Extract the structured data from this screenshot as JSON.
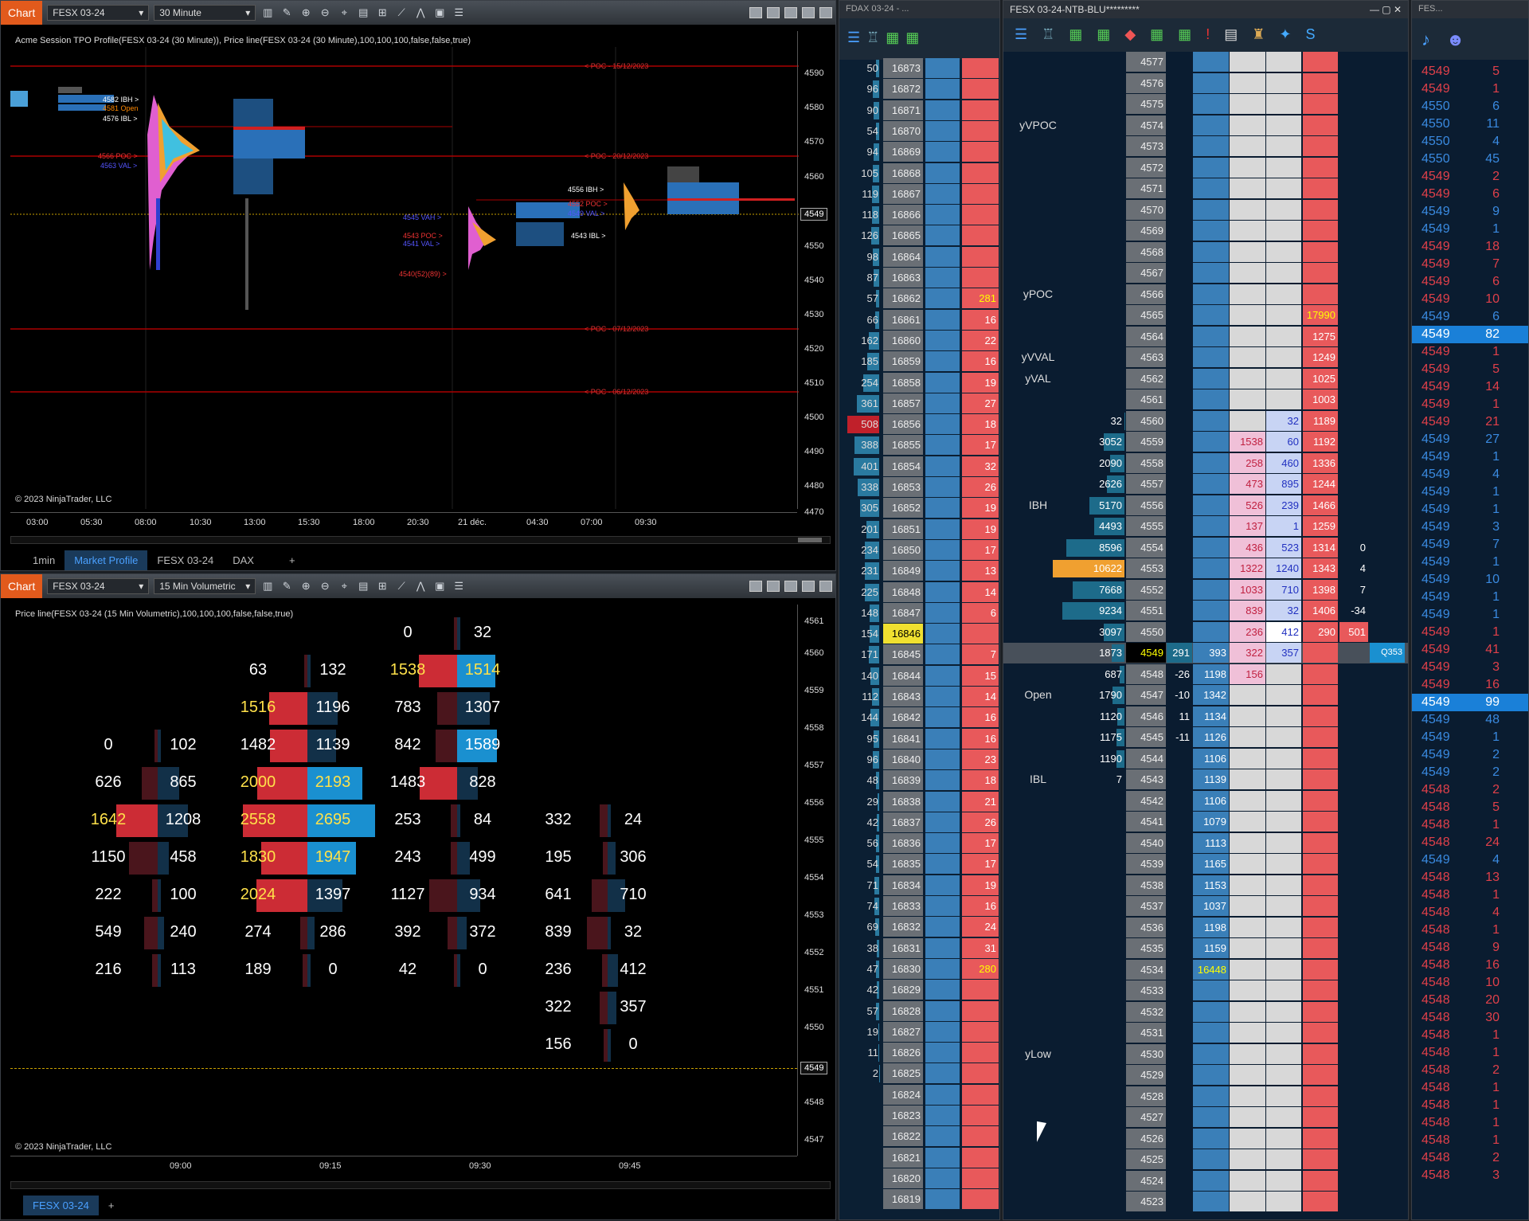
{
  "top_chart": {
    "tab_chip": "Chart",
    "instrument": "FESX 03-24",
    "interval": "30 Minute",
    "title": "Acme Session TPO Profile(FESX 03-24 (30 Minute)), Price line(FESX 03-24 (30 Minute),100,100,100,false,false,true)",
    "copyright": "© 2023 NinjaTrader, LLC",
    "price_axis": [
      "4590",
      "4580",
      "4570",
      "4560",
      "4550",
      "4540",
      "4530",
      "4520",
      "4510",
      "4500",
      "4490",
      "4480",
      "4470"
    ],
    "last_price": "4549",
    "time_axis": [
      "03:00",
      "05:30",
      "08:00",
      "10:30",
      "13:00",
      "15:30",
      "18:00",
      "20:30",
      "21 déc.",
      "04:30",
      "07:00",
      "09:30"
    ],
    "poc_lines": [
      "< POC - 15/12/2023",
      "< POC - 20/12/2023",
      "< POC - 07/12/2023",
      "< POC - 06/12/2023"
    ],
    "labels_left": [
      "4582 IBH >",
      "4581 Open",
      "4576 IBL >",
      "4566 POC >",
      "4563 VAL >"
    ],
    "labels_right": [
      "4556 IBH >",
      "4552 POC >",
      "4549 VAL >",
      "4543 IBL >",
      "4545 VAH >",
      "4543 POC >",
      "4541 VAL >",
      "4540(52)(89) >"
    ],
    "tabs": [
      "1min",
      "Market Profile",
      "FESX 03-24",
      "DAX",
      "+"
    ],
    "active_tab": "Market Profile"
  },
  "bottom_chart": {
    "tab_chip": "Chart",
    "instrument": "FESX 03-24",
    "interval": "15 Min Volumetric",
    "title": "Price line(FESX 03-24 (15 Min Volumetric),100,100,100,false,false,true)",
    "copyright": "© 2023 NinjaTrader, LLC",
    "price_axis": [
      "4561",
      "4560",
      "4559",
      "4558",
      "4557",
      "4556",
      "4555",
      "4554",
      "4553",
      "4552",
      "4551",
      "4550",
      "4549",
      "4548",
      "4547"
    ],
    "last_price": "4549",
    "time_axis": [
      "09:00",
      "09:15",
      "09:30",
      "09:45"
    ],
    "tabs": [
      "FESX 03-24",
      "+"
    ],
    "bars": [
      {
        "rows": [
          [
            "0",
            "102"
          ],
          [
            "626",
            "865"
          ],
          [
            "1642",
            "1208"
          ],
          [
            "1150",
            "458"
          ],
          [
            "222",
            "100"
          ],
          [
            "549",
            "240"
          ],
          [
            "216",
            "113"
          ]
        ]
      },
      {
        "rows": [
          [
            "63",
            "132"
          ],
          [
            "1516",
            "1196"
          ],
          [
            "1482",
            "1139"
          ],
          [
            "2000",
            "2193"
          ],
          [
            "2558",
            "2695"
          ],
          [
            "1830",
            "1947"
          ],
          [
            "2024",
            "1397"
          ],
          [
            "274",
            "286"
          ],
          [
            "189",
            "0"
          ]
        ]
      },
      {
        "rows": [
          [
            "0",
            "32"
          ],
          [
            "1538",
            "1514"
          ],
          [
            "783",
            "1307"
          ],
          [
            "842",
            "1589"
          ],
          [
            "1483",
            "828"
          ],
          [
            "253",
            "84"
          ],
          [
            "243",
            "499"
          ],
          [
            "1127",
            "934"
          ],
          [
            "392",
            "372"
          ],
          [
            "42",
            "0"
          ]
        ]
      },
      {
        "rows": [
          [
            "332",
            "24"
          ],
          [
            "195",
            "306"
          ],
          [
            "641",
            "710"
          ],
          [
            "839",
            "32"
          ],
          [
            "236",
            "412"
          ],
          [
            "322",
            "357"
          ],
          [
            "156",
            "0"
          ]
        ]
      }
    ]
  },
  "fdax_ladder": {
    "title": "FDAX 03-24 - ...",
    "rows": [
      [
        "50",
        "16873",
        ""
      ],
      [
        "96",
        "16872",
        ""
      ],
      [
        "90",
        "16871",
        ""
      ],
      [
        "54",
        "16870",
        ""
      ],
      [
        "94",
        "16869",
        ""
      ],
      [
        "105",
        "16868",
        ""
      ],
      [
        "119",
        "16867",
        ""
      ],
      [
        "118",
        "16866",
        ""
      ],
      [
        "126",
        "16865",
        ""
      ],
      [
        "98",
        "16864",
        ""
      ],
      [
        "87",
        "16863",
        ""
      ],
      [
        "57",
        "16862",
        "281"
      ],
      [
        "66",
        "16861",
        "16"
      ],
      [
        "162",
        "16860",
        "22"
      ],
      [
        "185",
        "16859",
        "16"
      ],
      [
        "254",
        "16858",
        "19"
      ],
      [
        "361",
        "16857",
        "27"
      ],
      [
        "508",
        "16856",
        "18"
      ],
      [
        "388",
        "16855",
        "17"
      ],
      [
        "401",
        "16854",
        "32"
      ],
      [
        "338",
        "16853",
        "26"
      ],
      [
        "305",
        "16852",
        "19"
      ],
      [
        "201",
        "16851",
        "19"
      ],
      [
        "234",
        "16850",
        "17"
      ],
      [
        "231",
        "16849",
        "13"
      ],
      [
        "225",
        "16848",
        "14"
      ],
      [
        "148",
        "16847",
        "6"
      ],
      [
        "154",
        "16846",
        ""
      ],
      [
        "171",
        "16845",
        "7"
      ],
      [
        "140",
        "16844",
        "15"
      ],
      [
        "112",
        "16843",
        "14"
      ],
      [
        "144",
        "16842",
        "16"
      ],
      [
        "95",
        "16841",
        "16"
      ],
      [
        "96",
        "16840",
        "23"
      ],
      [
        "48",
        "16839",
        "18"
      ],
      [
        "29",
        "16838",
        "21"
      ],
      [
        "42",
        "16837",
        "26"
      ],
      [
        "56",
        "16836",
        "17"
      ],
      [
        "54",
        "16835",
        "17"
      ],
      [
        "71",
        "16834",
        "19"
      ],
      [
        "74",
        "16833",
        "16"
      ],
      [
        "69",
        "16832",
        "24"
      ],
      [
        "38",
        "16831",
        "31"
      ],
      [
        "47",
        "16830",
        "280"
      ],
      [
        "42",
        "16829",
        ""
      ],
      [
        "57",
        "16828",
        ""
      ],
      [
        "19",
        "16827",
        ""
      ],
      [
        "11",
        "16826",
        ""
      ],
      [
        "2",
        "16825",
        ""
      ],
      [
        "",
        "16824",
        ""
      ],
      [
        "",
        "16823",
        ""
      ],
      [
        "",
        "16822",
        ""
      ],
      [
        "",
        "16821",
        ""
      ],
      [
        "",
        "16820",
        ""
      ],
      [
        "",
        "16819",
        ""
      ]
    ]
  },
  "fesx_ladder": {
    "title": "FESX 03-24-NTB-BLU*********",
    "rows": [
      {
        "p": "4577",
        "lbl": ""
      },
      {
        "p": "4576",
        "lbl": ""
      },
      {
        "p": "4575",
        "lbl": ""
      },
      {
        "p": "4574",
        "lbl": "yVPOC"
      },
      {
        "p": "4573",
        "lbl": ""
      },
      {
        "p": "4572",
        "lbl": ""
      },
      {
        "p": "4571",
        "lbl": ""
      },
      {
        "p": "4570",
        "lbl": ""
      },
      {
        "p": "4569",
        "lbl": ""
      },
      {
        "p": "4568",
        "lbl": ""
      },
      {
        "p": "4567",
        "lbl": ""
      },
      {
        "p": "4566",
        "lbl": "yPOC"
      },
      {
        "p": "4565",
        "lbl": "",
        "ask": "17990"
      },
      {
        "p": "4564",
        "lbl": "",
        "ask": "1275"
      },
      {
        "p": "4563",
        "lbl": "yVVAL",
        "ask": "1249"
      },
      {
        "p": "4562",
        "lbl": "yVAL",
        "ask": "1025"
      },
      {
        "p": "4561",
        "lbl": "",
        "ask": "1003"
      },
      {
        "p": "4560",
        "lbl": "",
        "vol": "32",
        "bs": "",
        "as": "32",
        "ask": "1189"
      },
      {
        "p": "4559",
        "lbl": "",
        "vol": "3052",
        "bs": "1538",
        "as": "60",
        "ask": "1192"
      },
      {
        "p": "4558",
        "lbl": "",
        "vol": "2090",
        "bs": "258",
        "as": "460",
        "ask": "1336"
      },
      {
        "p": "4557",
        "lbl": "",
        "vol": "2626",
        "bs": "473",
        "as": "895",
        "ask": "1244"
      },
      {
        "p": "4556",
        "lbl": "IBH",
        "vol": "5170",
        "bs": "526",
        "as": "239",
        "ask": "1466"
      },
      {
        "p": "4555",
        "lbl": "",
        "vol": "4493",
        "bs": "137",
        "as": "1",
        "ask": "1259"
      },
      {
        "p": "4554",
        "lbl": "",
        "vol": "8596",
        "bs": "436",
        "as": "523",
        "ask": "1314",
        "d": "0"
      },
      {
        "p": "4553",
        "lbl": "",
        "vol": "10622",
        "bs": "1322",
        "as": "1240",
        "ask": "1343",
        "d": "4"
      },
      {
        "p": "4552",
        "lbl": "",
        "vol": "7668",
        "bs": "1033",
        "as": "710",
        "ask": "1398",
        "d": "7"
      },
      {
        "p": "4551",
        "lbl": "",
        "vol": "9234",
        "bs": "839",
        "as": "32",
        "ask": "1406",
        "d": "-34"
      },
      {
        "p": "4550",
        "lbl": "",
        "vol": "3097",
        "bs": "236",
        "as": "412",
        "ask": "290",
        "d": "501"
      },
      {
        "p": "4549",
        "lbl": "",
        "vol": "1873",
        "bid": "393",
        "bs": "322",
        "as": "357",
        "dl": "291",
        "cur": "Q353"
      },
      {
        "p": "4548",
        "lbl": "",
        "vol": "687",
        "bid": "1198",
        "bs": "156",
        "dl": "-26"
      },
      {
        "p": "4547",
        "lbl": "Open",
        "vol": "1790",
        "bid": "1342",
        "dl": "-10"
      },
      {
        "p": "4546",
        "lbl": "",
        "vol": "1120",
        "bid": "1134",
        "dl": "11"
      },
      {
        "p": "4545",
        "lbl": "",
        "vol": "1175",
        "bid": "1126",
        "dl": "-11"
      },
      {
        "p": "4544",
        "lbl": "",
        "vol": "1190",
        "bid": "1106"
      },
      {
        "p": "4543",
        "lbl": "IBL",
        "vol": "7",
        "bid": "1139"
      },
      {
        "p": "4542",
        "lbl": "",
        "bid": "1106"
      },
      {
        "p": "4541",
        "lbl": "",
        "bid": "1079"
      },
      {
        "p": "4540",
        "lbl": "",
        "bid": "1113"
      },
      {
        "p": "4539",
        "lbl": "",
        "bid": "1165"
      },
      {
        "p": "4538",
        "lbl": "",
        "bid": "1153"
      },
      {
        "p": "4537",
        "lbl": "",
        "bid": "1037"
      },
      {
        "p": "4536",
        "lbl": "",
        "bid": "1198"
      },
      {
        "p": "4535",
        "lbl": "",
        "bid": "1159"
      },
      {
        "p": "4534",
        "lbl": "",
        "bid": "16448"
      },
      {
        "p": "4533",
        "lbl": ""
      },
      {
        "p": "4532",
        "lbl": ""
      },
      {
        "p": "4531",
        "lbl": ""
      },
      {
        "p": "4530",
        "lbl": "yLow"
      },
      {
        "p": "4529",
        "lbl": ""
      },
      {
        "p": "4528",
        "lbl": ""
      },
      {
        "p": "4527",
        "lbl": ""
      },
      {
        "p": "4526",
        "lbl": ""
      },
      {
        "p": "4525",
        "lbl": ""
      },
      {
        "p": "4524",
        "lbl": ""
      },
      {
        "p": "4523",
        "lbl": ""
      }
    ]
  },
  "tape": {
    "title": "FES...",
    "rows": [
      [
        "4549",
        "5",
        "r"
      ],
      [
        "4549",
        "1",
        "r"
      ],
      [
        "4550",
        "6",
        "b"
      ],
      [
        "4550",
        "11",
        "b"
      ],
      [
        "4550",
        "4",
        "b"
      ],
      [
        "4550",
        "45",
        "b"
      ],
      [
        "4549",
        "2",
        "r"
      ],
      [
        "4549",
        "6",
        "r"
      ],
      [
        "4549",
        "9",
        "b"
      ],
      [
        "4549",
        "1",
        "b"
      ],
      [
        "4549",
        "18",
        "r"
      ],
      [
        "4549",
        "7",
        "r"
      ],
      [
        "4549",
        "6",
        "r"
      ],
      [
        "4549",
        "10",
        "r"
      ],
      [
        "4549",
        "6",
        "b"
      ],
      [
        "4549",
        "82",
        "hl"
      ],
      [
        "4549",
        "1",
        "r"
      ],
      [
        "4549",
        "5",
        "r"
      ],
      [
        "4549",
        "14",
        "r"
      ],
      [
        "4549",
        "1",
        "r"
      ],
      [
        "4549",
        "21",
        "r"
      ],
      [
        "4549",
        "27",
        "b"
      ],
      [
        "4549",
        "1",
        "b"
      ],
      [
        "4549",
        "4",
        "b"
      ],
      [
        "4549",
        "1",
        "b"
      ],
      [
        "4549",
        "1",
        "b"
      ],
      [
        "4549",
        "3",
        "b"
      ],
      [
        "4549",
        "7",
        "b"
      ],
      [
        "4549",
        "1",
        "b"
      ],
      [
        "4549",
        "10",
        "b"
      ],
      [
        "4549",
        "1",
        "b"
      ],
      [
        "4549",
        "1",
        "b"
      ],
      [
        "4549",
        "1",
        "r"
      ],
      [
        "4549",
        "41",
        "r"
      ],
      [
        "4549",
        "3",
        "r"
      ],
      [
        "4549",
        "16",
        "r"
      ],
      [
        "4549",
        "99",
        "hl"
      ],
      [
        "4549",
        "48",
        "b"
      ],
      [
        "4549",
        "1",
        "b"
      ],
      [
        "4549",
        "2",
        "b"
      ],
      [
        "4549",
        "2",
        "b"
      ],
      [
        "4548",
        "2",
        "r"
      ],
      [
        "4548",
        "5",
        "r"
      ],
      [
        "4548",
        "1",
        "r"
      ],
      [
        "4548",
        "24",
        "r"
      ],
      [
        "4549",
        "4",
        "b"
      ],
      [
        "4548",
        "13",
        "r"
      ],
      [
        "4548",
        "1",
        "r"
      ],
      [
        "4548",
        "4",
        "r"
      ],
      [
        "4548",
        "1",
        "r"
      ],
      [
        "4548",
        "9",
        "r"
      ],
      [
        "4548",
        "16",
        "r"
      ],
      [
        "4548",
        "10",
        "r"
      ],
      [
        "4548",
        "20",
        "r"
      ],
      [
        "4548",
        "30",
        "r"
      ],
      [
        "4548",
        "1",
        "r"
      ],
      [
        "4548",
        "1",
        "r"
      ],
      [
        "4548",
        "2",
        "r"
      ],
      [
        "4548",
        "1",
        "r"
      ],
      [
        "4548",
        "1",
        "r"
      ],
      [
        "4548",
        "1",
        "r"
      ],
      [
        "4548",
        "1",
        "r"
      ],
      [
        "4548",
        "2",
        "r"
      ],
      [
        "4548",
        "3",
        "r"
      ]
    ]
  }
}
